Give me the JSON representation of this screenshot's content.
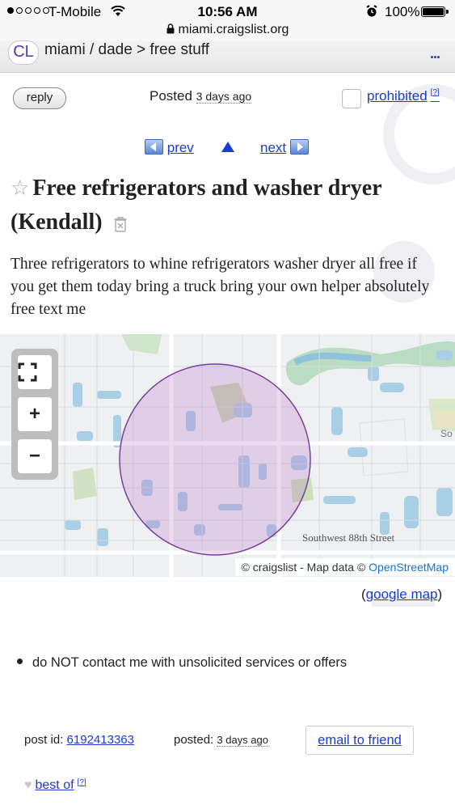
{
  "status_bar": {
    "carrier": "T-Mobile",
    "time": "10:56 AM",
    "battery": "100%",
    "battery_level": 1.0,
    "signal_bars_filled": 1,
    "signal_bars_total": 5,
    "icons": [
      "signal-dots-icon",
      "wifi-icon",
      "alarm-clock-icon",
      "battery-icon"
    ]
  },
  "browser": {
    "url": "miami.craigslist.org",
    "lock_icon": "lock-icon"
  },
  "header": {
    "logo": "CL",
    "breadcrumb": "miami / dade > free stuff",
    "menu": "..."
  },
  "post_actions": {
    "reply": "reply",
    "posted_label": "Posted",
    "posted_ago": "3 days ago",
    "prohibited": "prohibited",
    "help": "?"
  },
  "nav": {
    "prev": "prev",
    "next": "next"
  },
  "post": {
    "title": "Free refrigerators and washer dryer",
    "location": "(Kendall)",
    "body": "Three refrigerators to whine refrigerators washer dryer all free if you get them today bring a truck bring your own helper absolutely free text me"
  },
  "map": {
    "zoom_in": "+",
    "zoom_out": "−",
    "street_label": "Southwest 88th Street",
    "edge_label": "So",
    "attribution_prefix": "© craigslist - Map data ©",
    "attribution_link": "OpenStreetMap",
    "google_open": "(",
    "google_link": "google map",
    "google_close": ")"
  },
  "notices": {
    "items": [
      "do NOT contact me with unsolicited services or offers"
    ]
  },
  "footer": {
    "post_id_label": "post id:",
    "post_id": "6192413363",
    "posted_label": "posted:",
    "posted_ago": "3 days ago",
    "email_friend": "email to friend",
    "best_of": "best of",
    "help": "?"
  },
  "colors": {
    "link": "#1a3bd6",
    "logo_purple": "#5b34a8",
    "map_circle": "#7a3fa0"
  }
}
